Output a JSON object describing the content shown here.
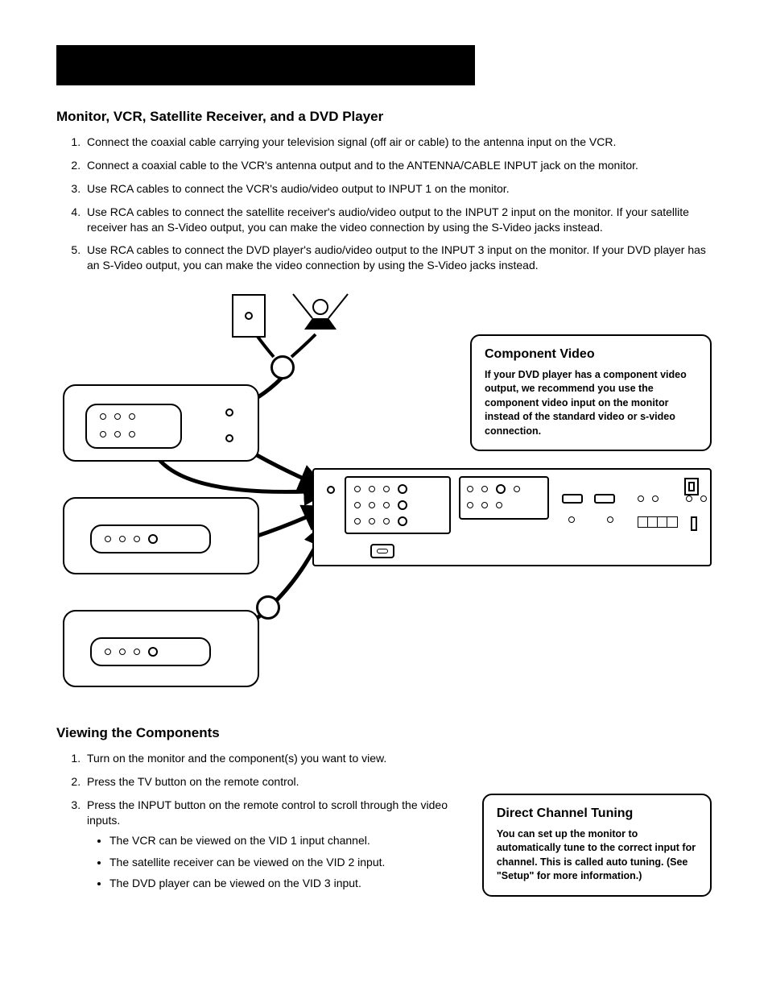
{
  "header": {
    "chapter_banner": ""
  },
  "section1": {
    "title": "Monitor, VCR, Satellite Receiver, and a DVD Player",
    "steps": [
      "Connect the coaxial cable carrying your television signal (off air or cable) to the antenna input on the VCR.",
      "Connect a coaxial cable to the VCR's antenna output and to the ANTENNA/CABLE INPUT jack on the monitor.",
      "Use RCA cables to connect the VCR's audio/video output to INPUT 1 on the monitor.",
      "Use RCA cables to connect the satellite receiver's audio/video output to the INPUT 2 input on the monitor. If your satellite receiver has an S-Video output, you can make the video connection by using the S-Video jacks instead.",
      "Use RCA cables to connect the DVD player's audio/video output to the INPUT 3 input on the monitor. If your DVD player has an S-Video output, you can make the video connection by using the S-Video jacks instead."
    ]
  },
  "callout_component": {
    "title": "Component Video",
    "body": "If your DVD player has a component video output, we recommend you use the component video input on the monitor instead of the standard video or s-video connection."
  },
  "section2": {
    "title": "Viewing the Components",
    "steps": [
      "Turn on the monitor and the component(s) you want to view.",
      "Press the TV button on the remote control.",
      "Press the INPUT button on the remote control to scroll through the video inputs."
    ],
    "sub_bullets": [
      "The VCR can be viewed on the VID 1 input channel.",
      "The satellite receiver can be viewed on the VID 2 input.",
      "The DVD player can be viewed on the VID 3 input."
    ]
  },
  "callout_tuning": {
    "title": "Direct Channel Tuning",
    "body": "You can set up the monitor to automatically tune to the correct input for channel. This is called auto tuning. (See \"Setup\" for more information.)"
  },
  "diagram": {
    "devices": {
      "wall_outlet": "cable-wall-outlet",
      "antenna": "off-air-antenna",
      "vcr": "vcr-rear-panel",
      "satellite": "satellite-receiver-rear-panel",
      "dvd": "dvd-player-rear-panel",
      "monitor": "monitor-rear-panel"
    }
  }
}
